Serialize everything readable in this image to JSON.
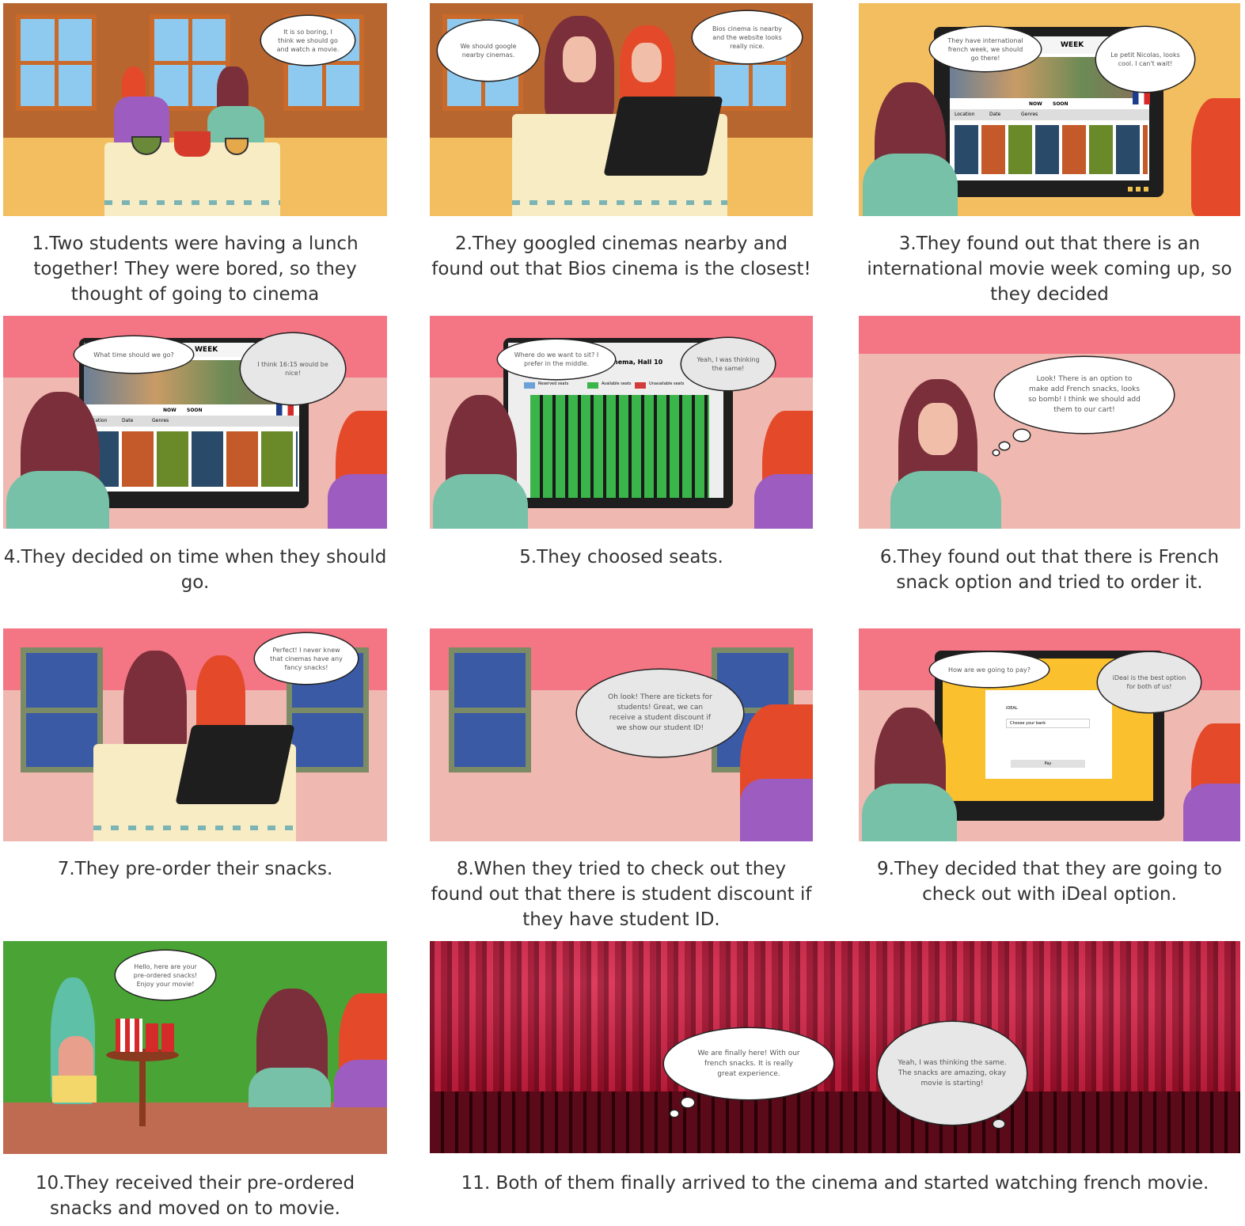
{
  "panels": [
    {
      "caption": "1.Two students were having a lunch together! They were bored, so they thought of going to cinema",
      "bubbles": [
        "It is so boring, I think we should go and watch a movie."
      ]
    },
    {
      "caption": "2.They googled cinemas nearby and found out that Bios cinema is the closest!",
      "bubbles": [
        "We should google nearby cinemas.",
        "Bios cinema is nearby and the website looks really nice."
      ]
    },
    {
      "caption": "3.They found out that there is an international movie week coming up, so they decided",
      "bubbles": [
        "They have international french week, we should go there!",
        "Le petit Nicolas, looks cool. I can't wait!"
      ],
      "screen": {
        "header": "WEEK",
        "tabs": [
          "NOW",
          "SOON"
        ],
        "filters": [
          "Location",
          "Date",
          "Genres"
        ]
      }
    },
    {
      "caption": "4.They decided on time when they should go.",
      "bubbles": [
        "What time should we go?",
        "I think 16:15 would be nice!"
      ],
      "screen": {
        "header": "WEEK",
        "tabs": [
          "NOW",
          "SOON"
        ],
        "filters": [
          "Location",
          "Date",
          "Genres"
        ]
      }
    },
    {
      "caption": "5.They choosed seats.",
      "bubbles": [
        "Where do we want to sit? I prefer in the middle.",
        "Yeah, I was thinking the same!"
      ],
      "screen": {
        "header": "BIOS Cinema, Hall 10",
        "legend": [
          "Reserved seats",
          "Available seats",
          "Unavailable seats"
        ]
      }
    },
    {
      "caption": "6.They found out that there is French snack option and tried to order it.",
      "bubbles": [
        "Look! There is an option to make add French snacks, looks so bomb! I think we should add them to our cart!"
      ]
    },
    {
      "caption": "7.They pre-order their snacks.",
      "bubbles": [
        "Perfect! I never knew that cinemas have any fancy snacks!"
      ]
    },
    {
      "caption": "8.When they tried to check out they found out that there is student discount if they have student ID.",
      "bubbles": [
        "Oh look! There are tickets for students! Great, we can receive a student discount if we show our student ID!"
      ]
    },
    {
      "caption": "9.They decided that they are going to check out with iDeal option.",
      "bubbles": [
        "How are we going to pay?",
        "iDeal is the best option for both of us!"
      ],
      "screen": {
        "options": [
          "iDEAL",
          "Choose your bank",
          "Pay"
        ]
      }
    },
    {
      "caption": "10.They received their pre-ordered snacks and moved on to movie.",
      "bubbles": [
        "Hello, here are your pre-ordered snacks! Enjoy your movie!"
      ]
    },
    {
      "caption": "11. Both of them finally arrived to the cinema and started watching french movie.",
      "bubbles": [
        "We are finally here! With our french snacks. It is really great experience.",
        "Yeah, I was thinking the same. The snacks are amazing, okay movie is starting!"
      ]
    }
  ],
  "colors": {
    "orange_wall": "#b8662f",
    "yellow_floor": "#f2be5f",
    "pink_wall": "#f47584",
    "pink_floor": "#efb8b0",
    "green_wall": "#4aa435",
    "curtain": "#b0102e"
  }
}
